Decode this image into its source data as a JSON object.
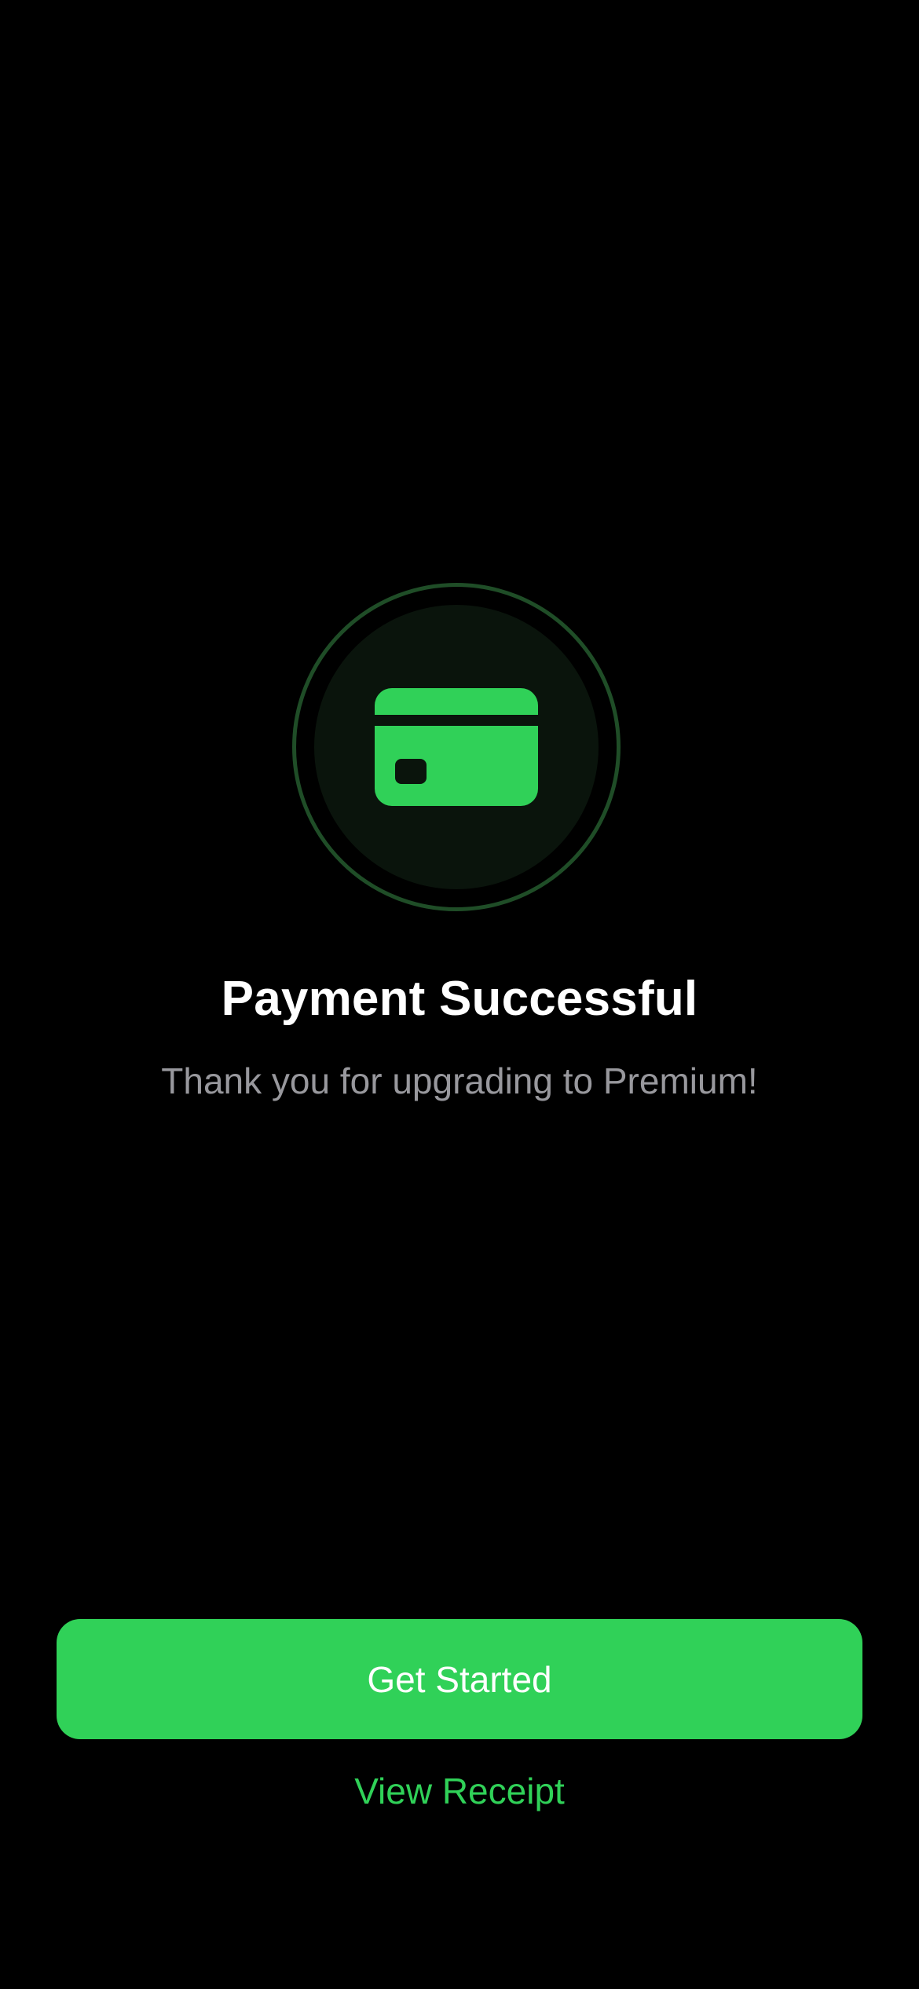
{
  "colors": {
    "background": "#000000",
    "accent": "#30d158",
    "ring": "#1f4d27",
    "disc": "#0a140c",
    "title": "#ffffff",
    "subtitle": "#98989d"
  },
  "status_icon": {
    "icon": "credit-card-icon"
  },
  "content": {
    "title": "Payment Successful",
    "subtitle": "Thank you for upgrading to Premium!"
  },
  "actions": {
    "primary_label": "Get Started",
    "secondary_label": "View Receipt"
  }
}
